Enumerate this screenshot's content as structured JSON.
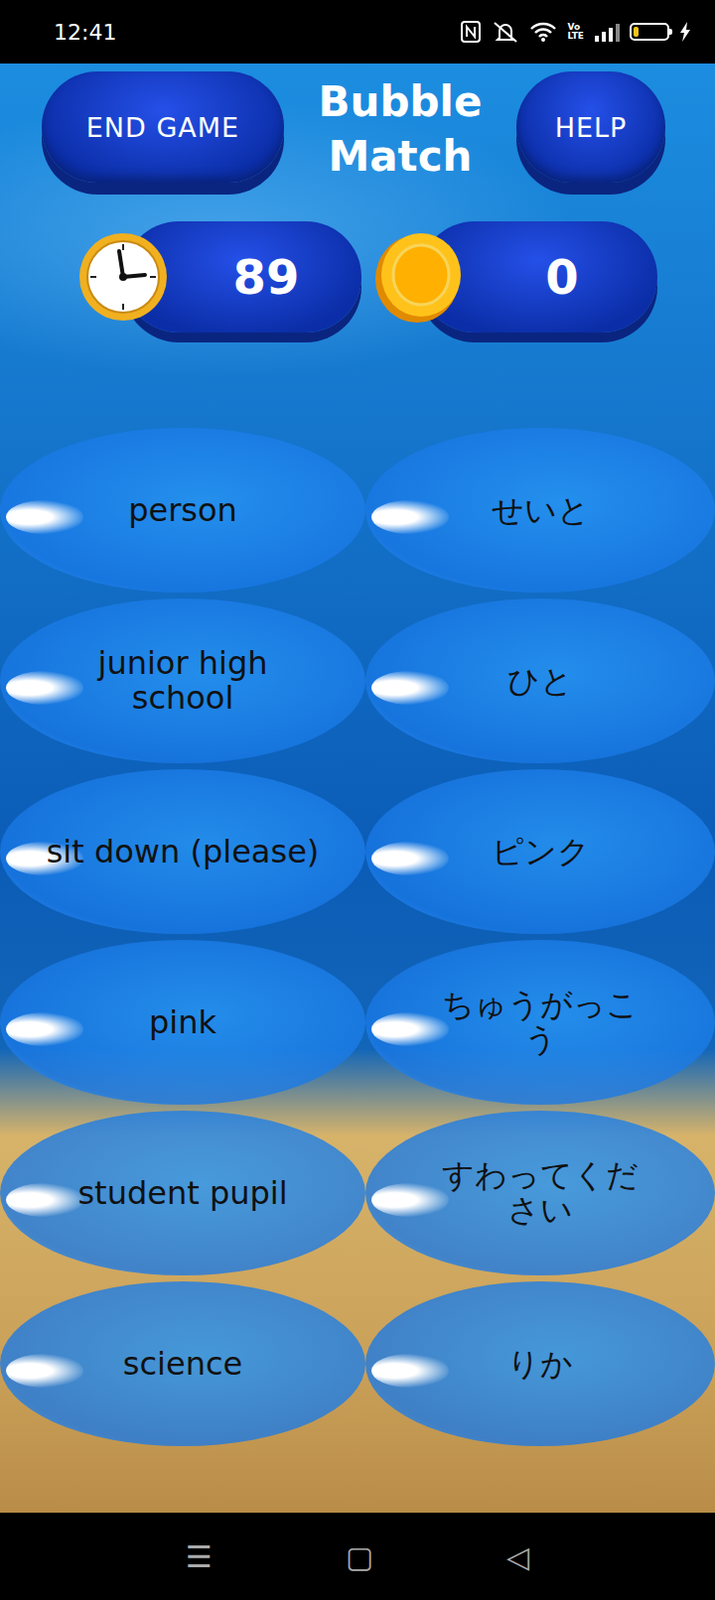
{
  "status_bar": {
    "time": "12:41",
    "volte": [
      "Vo",
      "LTE"
    ],
    "battery": {
      "level": 0.15
    }
  },
  "header": {
    "end_button": "END GAME",
    "title": "Bubble Match",
    "help_button": "HELP"
  },
  "counters": {
    "timer": "89",
    "coins": "0"
  },
  "bubbles": {
    "left": [
      "person",
      "junior high school",
      "sit down (please)",
      "pink",
      "student pupil",
      "science"
    ],
    "right": [
      "せいと",
      "ひと",
      "ピンク",
      "ちゅうがっこう",
      "すわってください",
      "りか"
    ]
  },
  "nav": {
    "buttons": [
      "☰",
      "▢",
      "◁"
    ]
  }
}
